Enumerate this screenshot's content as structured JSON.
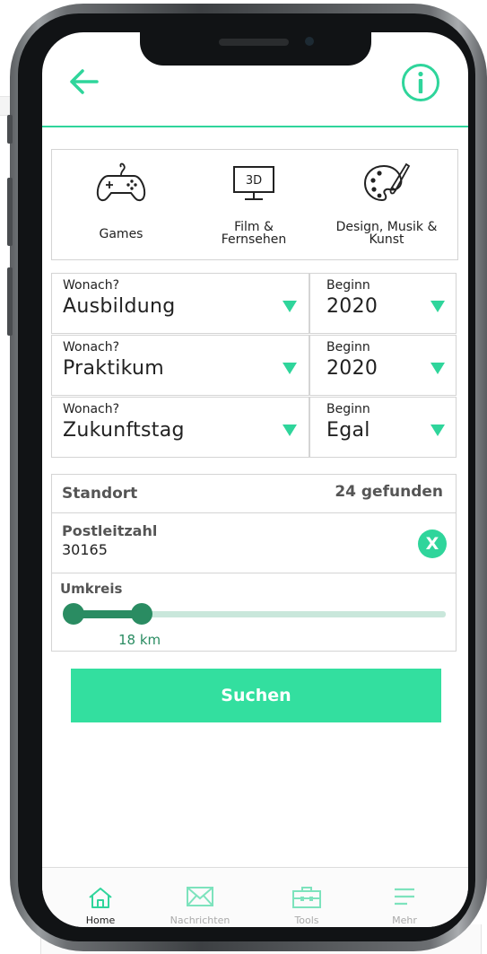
{
  "header": {
    "back_icon": "arrow-left-icon",
    "info_icon": "info-circle-icon",
    "accent_color": "#2fd59b"
  },
  "categories": [
    {
      "label": "Games",
      "icon": "gamepad-icon"
    },
    {
      "label_line1": "Film &",
      "label_line2": "Fernsehen",
      "icon": "3d-monitor-icon"
    },
    {
      "label_line1": "Design, Musik &",
      "label_line2": "Kunst",
      "icon": "palette-icon"
    }
  ],
  "filters": [
    {
      "what_label": "Wonach?",
      "what_value": "Ausbildung",
      "start_label": "Beginn",
      "start_value": "2020"
    },
    {
      "what_label": "Wonach?",
      "what_value": "Praktikum",
      "start_label": "Beginn",
      "start_value": "2020"
    },
    {
      "what_label": "Wonach?",
      "what_value": "Zukunftstag",
      "start_label": "Beginn",
      "start_value": "Egal"
    }
  ],
  "location": {
    "title": "Standort",
    "found": "24 gefunden",
    "plz_label": "Postleitzahl",
    "plz_value": "30165",
    "clear_label": "X",
    "radius_label": "Umkreis",
    "radius_value": "18 km",
    "radius_fraction": 0.18
  },
  "search_button": "Suchen",
  "nav": [
    {
      "label": "Home",
      "icon": "home-icon",
      "active": true
    },
    {
      "label": "Nachrichten",
      "icon": "envelope-icon",
      "active": false
    },
    {
      "label": "Tools",
      "icon": "toolbox-icon",
      "active": false
    },
    {
      "label": "Mehr",
      "icon": "menu-icon",
      "active": false
    }
  ],
  "colors": {
    "accent": "#2fd59b",
    "button": "#33df9f",
    "slider": "#2a8c62"
  }
}
